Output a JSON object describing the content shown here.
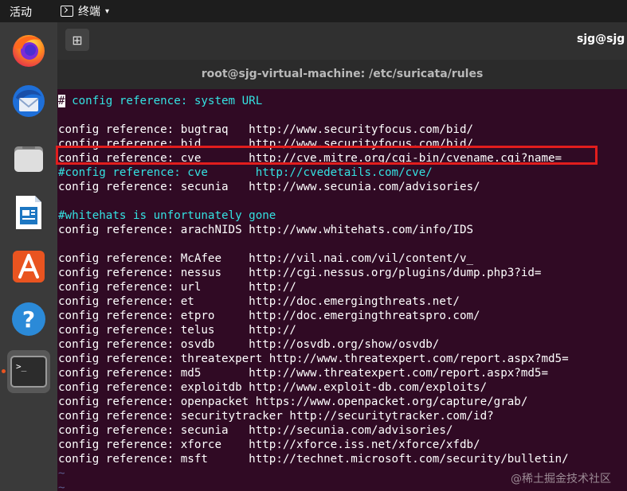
{
  "topbar": {
    "activities_label": "活动",
    "app_menu_label": "终端",
    "app_menu_caret": "▾"
  },
  "terminal_header": {
    "new_tab_glyph": "⊞",
    "host_label": "sjg@sjg"
  },
  "window": {
    "title": "root@sjg-virtual-machine: /etc/suricata/rules"
  },
  "terminal": {
    "first_comment_rest": " config reference: system URL",
    "lines": [
      {
        "kind": "blank",
        "text": ""
      },
      {
        "kind": "text",
        "text": "config reference: bugtraq   http://www.securityfocus.com/bid/"
      },
      {
        "kind": "text",
        "text": "config reference: bid       http://www.securityfocus.com/bid/"
      },
      {
        "kind": "text",
        "text": "config reference: cve       http://cve.mitre.org/cgi-bin/cvename.cgi?name="
      },
      {
        "kind": "comment",
        "text": "#config reference: cve       http://cvedetails.com/cve/"
      },
      {
        "kind": "text",
        "text": "config reference: secunia   http://www.secunia.com/advisories/"
      },
      {
        "kind": "blank",
        "text": ""
      },
      {
        "kind": "comment",
        "text": "#whitehats is unfortunately gone"
      },
      {
        "kind": "text",
        "text": "config reference: arachNIDS http://www.whitehats.com/info/IDS"
      },
      {
        "kind": "blank",
        "text": ""
      },
      {
        "kind": "text",
        "text": "config reference: McAfee    http://vil.nai.com/vil/content/v_"
      },
      {
        "kind": "text",
        "text": "config reference: nessus    http://cgi.nessus.org/plugins/dump.php3?id="
      },
      {
        "kind": "text",
        "text": "config reference: url       http://"
      },
      {
        "kind": "text",
        "text": "config reference: et        http://doc.emergingthreats.net/"
      },
      {
        "kind": "text",
        "text": "config reference: etpro     http://doc.emergingthreatspro.com/"
      },
      {
        "kind": "text",
        "text": "config reference: telus     http://"
      },
      {
        "kind": "text",
        "text": "config reference: osvdb     http://osvdb.org/show/osvdb/"
      },
      {
        "kind": "text",
        "text": "config reference: threatexpert http://www.threatexpert.com/report.aspx?md5="
      },
      {
        "kind": "text",
        "text": "config reference: md5       http://www.threatexpert.com/report.aspx?md5="
      },
      {
        "kind": "text",
        "text": "config reference: exploitdb http://www.exploit-db.com/exploits/"
      },
      {
        "kind": "text",
        "text": "config reference: openpacket https://www.openpacket.org/capture/grab/"
      },
      {
        "kind": "text",
        "text": "config reference: securitytracker http://securitytracker.com/id?"
      },
      {
        "kind": "text",
        "text": "config reference: secunia   http://secunia.com/advisories/"
      },
      {
        "kind": "text",
        "text": "config reference: xforce    http://xforce.iss.net/xforce/xfdb/"
      },
      {
        "kind": "text",
        "text": "config reference: msft      http://technet.microsoft.com/security/bulletin/"
      },
      {
        "kind": "tilde",
        "text": "~"
      },
      {
        "kind": "tilde",
        "text": "~"
      }
    ]
  },
  "watermark": "@稀土掘金技术社区",
  "colors": {
    "terminal_bg": "#300a24",
    "comment": "#34e2e2",
    "highlight_box": "#e11d1d",
    "dock_bg": "#3a3a3a"
  },
  "icons": {
    "dock": [
      "firefox-icon",
      "thunderbird-icon",
      "files-icon",
      "writer-icon",
      "app-center-icon",
      "help-icon",
      "terminal-icon"
    ]
  }
}
